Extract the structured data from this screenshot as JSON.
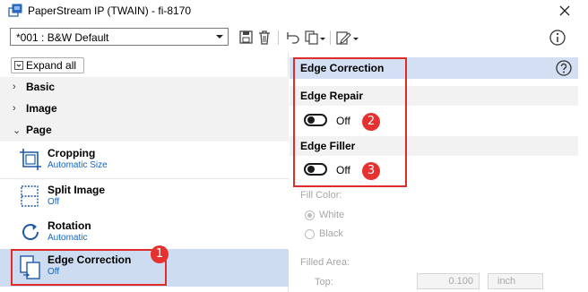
{
  "window": {
    "title": "PaperStream IP (TWAIN) - fi-8170"
  },
  "toolbar": {
    "profile_value": "*001 : B&W Default"
  },
  "left": {
    "expand_all_label": "Expand all",
    "sections": [
      {
        "label": "Basic"
      },
      {
        "label": "Image"
      },
      {
        "label": "Page"
      }
    ],
    "items": [
      {
        "name": "Cropping",
        "value": "Automatic Size"
      },
      {
        "name": "Split Image",
        "value": "Off"
      },
      {
        "name": "Rotation",
        "value": "Automatic"
      },
      {
        "name": "Edge Correction",
        "value": "Off"
      }
    ]
  },
  "right": {
    "header": "Edge Correction",
    "edge_repair": {
      "label": "Edge Repair",
      "state": "Off"
    },
    "edge_filler": {
      "label": "Edge Filler",
      "state": "Off"
    },
    "fill_color_label": "Fill Color:",
    "fill_options": [
      "White",
      "Black"
    ],
    "filled_area_label": "Filled Area:",
    "top_label": "Top:",
    "top_value": "0.100",
    "top_unit": "inch"
  },
  "annotations": {
    "badges": [
      "1",
      "2",
      "3"
    ]
  },
  "colors": {
    "selected_row": "#cddcf1",
    "header_bg": "#d3e0f3",
    "link_value": "#1565c0",
    "annotation_red": "#e02b2b"
  }
}
